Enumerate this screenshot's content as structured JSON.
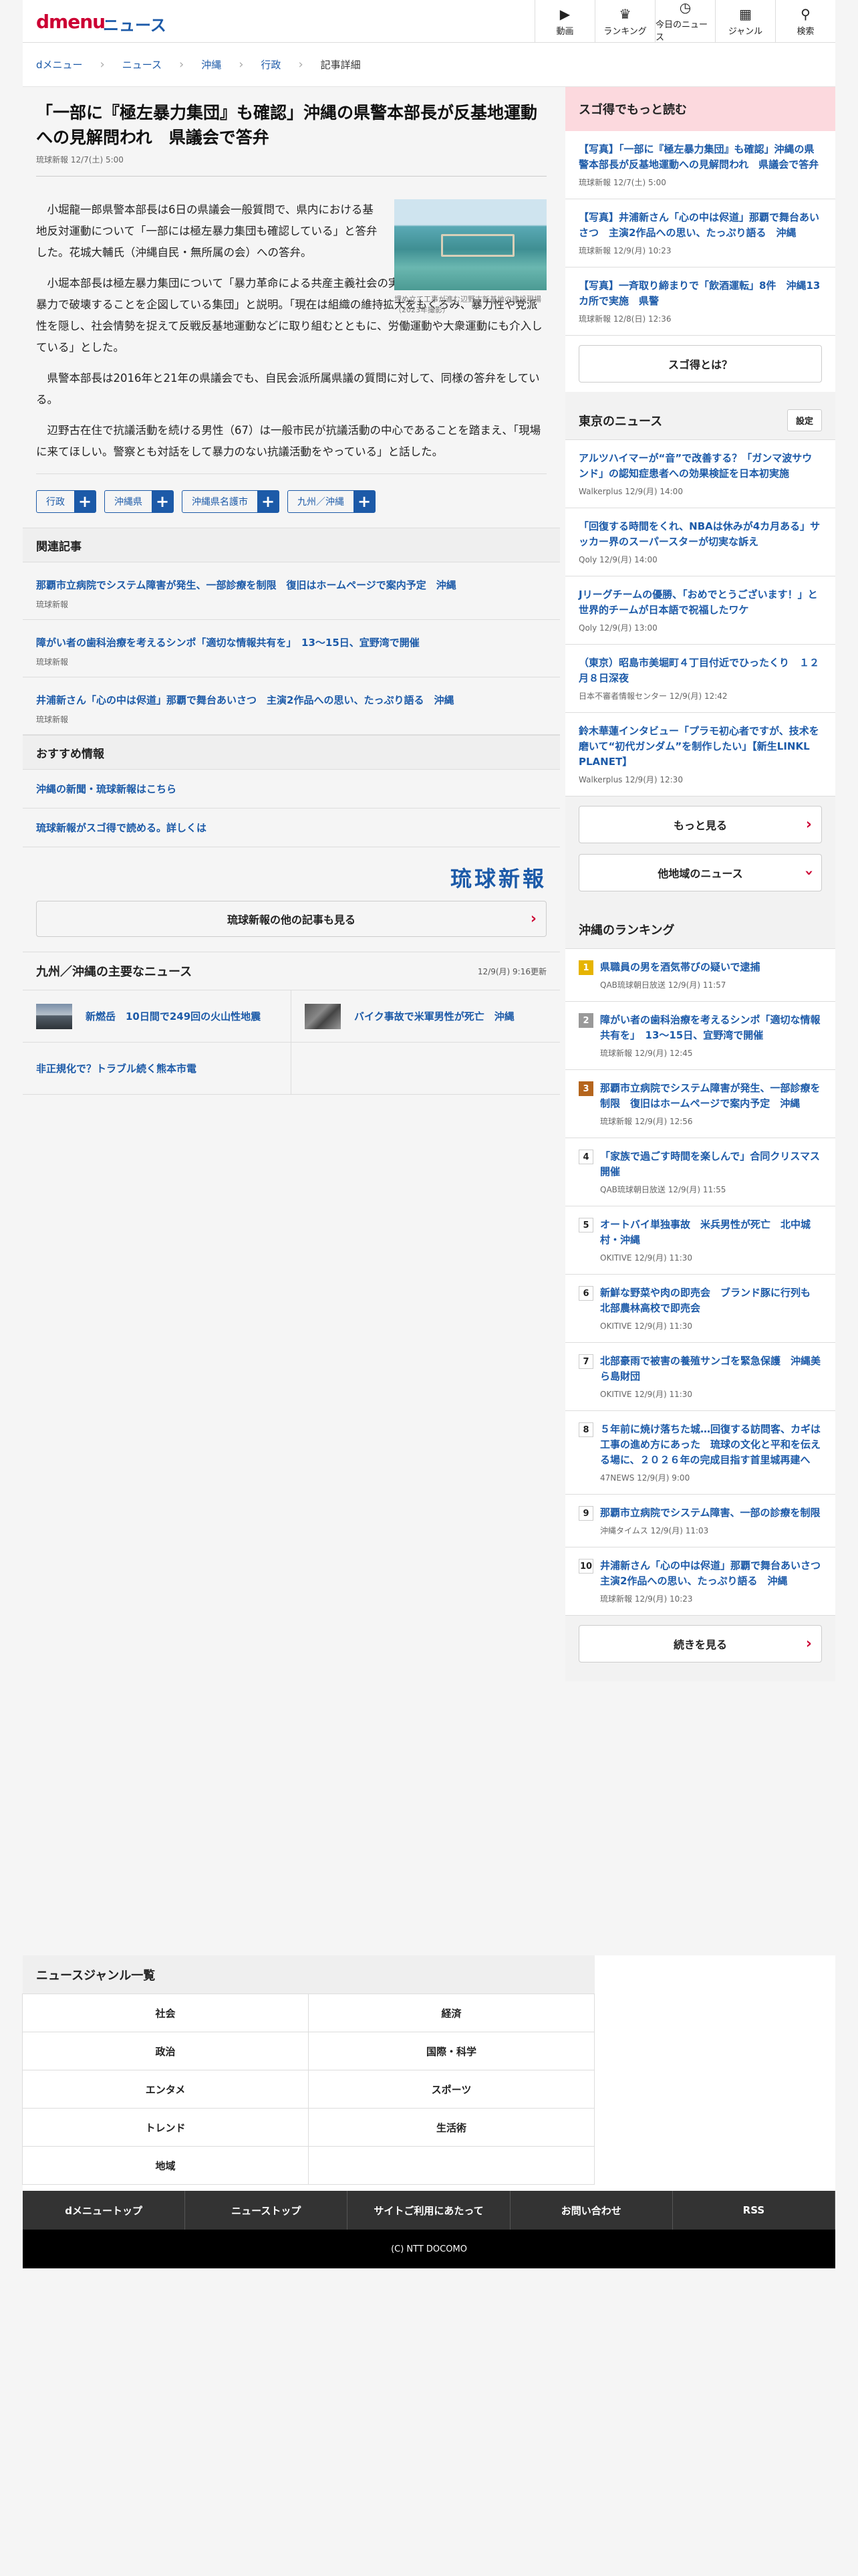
{
  "header": {
    "logo": "dmenu",
    "section": "ニュース",
    "nav": [
      {
        "icon": "video-icon",
        "glyph": "▶",
        "label": "動画"
      },
      {
        "icon": "trophy-icon",
        "glyph": "♛",
        "label": "ランキング"
      },
      {
        "icon": "clock-icon",
        "glyph": "◷",
        "label": "今日のニュース"
      },
      {
        "icon": "grid-icon",
        "glyph": "▦",
        "label": "ジャンル"
      },
      {
        "icon": "search-icon",
        "glyph": "⚲",
        "label": "検索"
      }
    ]
  },
  "breadcrumb": [
    "dメニュー",
    "ニュース",
    "沖縄",
    "行政",
    "記事詳細"
  ],
  "article": {
    "title": "「一部に『極左暴力集団』も確認」沖縄の県警本部長が反基地運動への見解問われ　県議会で答弁",
    "source": "琉球新報 12/7(土) 5:00",
    "caption": "埋め立て工事が進む辺野古新基地の建設現場（2023年撮影）",
    "paragraphs": [
      "小堀龍一郎県警本部長は6日の県議会一般質問で、県内における基地反対運動について「一部には極左暴力集団も確認している」と答弁した。花城大輔氏（沖縄自民・無所属の会）への答弁。",
      "小堀本部長は極左暴力集団について「暴力革命による共産主義社会の実現を目指し、民主主義社会を暴力で破壊することを企図している集団」と説明。「現在は組織の維持拡大をもくろみ、暴力性や党派性を隠し、社会情勢を捉えて反戦反基地運動などに取り組むとともに、労働運動や大衆運動にも介入している」とした。",
      "県警本部長は2016年と21年の県議会でも、自民会派所属県議の質問に対して、同様の答弁をしている。",
      "辺野古在住で抗議活動を続ける男性（67）は一般市民が抗議活動の中心であることを踏まえ、「現場に来てほしい。警察とも対話をして暴力のない抗議活動をやっている」と話した。"
    ],
    "tags": [
      "行政",
      "沖縄県",
      "沖縄県名護市",
      "九州／沖縄"
    ]
  },
  "related": {
    "heading": "関連記事",
    "items": [
      {
        "title": "那覇市立病院でシステム障害が発生、一部診療を制限　復旧はホームページで案内予定　沖縄",
        "source": "琉球新報"
      },
      {
        "title": "障がい者の歯科治療を考えるシンポ「適切な情報共有を」　13～15日、宜野湾で開催",
        "source": "琉球新報"
      },
      {
        "title": "井浦新さん「心の中は侭道」那覇で舞台あいさつ　主演2作品への思い、たっぷり語る　沖縄",
        "source": "琉球新報"
      }
    ]
  },
  "recommend": {
    "heading": "おすすめ情報",
    "items": [
      "沖縄の新聞・琉球新報はこちら",
      "琉球新報がスゴ得で読める。詳しくは"
    ],
    "brand": "琉球新報",
    "more": "琉球新報の他の記事も見る"
  },
  "kyushu": {
    "heading": "九州／沖縄の主要なニュース",
    "date": "12/9(月) 9:16更新",
    "items": [
      "新燃岳　10日間で249回の火山性地震",
      "バイク事故で米軍男性が死亡　沖縄",
      "非正規化で？トラブル続く熊本市電"
    ]
  },
  "sugoku": {
    "heading": "スゴ得でもっと読む",
    "items": [
      {
        "title": "【写真】「一部に『極左暴力集団』も確認」沖縄の県警本部長が反基地運動への見解問われ　県議会で答弁",
        "source": "琉球新報 12/7(土) 5:00"
      },
      {
        "title": "【写真】井浦新さん「心の中は侭道」那覇で舞台あいさつ　主演2作品への思い、たっぷり語る　沖縄",
        "source": "琉球新報 12/9(月) 10:23"
      },
      {
        "title": "【写真】一斉取り締まりで「飲酒運転」8件　沖縄13カ所で実施　県警",
        "source": "琉球新報 12/8(日) 12:36"
      }
    ],
    "button": "スゴ得とは？"
  },
  "tokyo": {
    "heading": "東京のニュース",
    "setting": "設定",
    "items": [
      {
        "title": "アルツハイマーが“音”で改善する？「ガンマ波サウンド」の認知症患者への効果検証を日本初実施",
        "source": "Walkerplus 12/9(月) 14:00"
      },
      {
        "title": "「回復する時間をくれ、NBAは休みが4カ月ある」サッカー界のスーパースターが切実な訴え",
        "source": "Qoly 12/9(月) 14:00"
      },
      {
        "title": "Jリーグチームの優勝、「おめでとうございます！」と世界的チームが日本語で祝福したワケ",
        "source": "Qoly 12/9(月) 13:00"
      },
      {
        "title": "（東京）昭島市美堀町４丁目付近でひったくり　１２月８日深夜",
        "source": "日本不審者情報センター 12/9(月) 12:42"
      },
      {
        "title": "鈴木華蓮インタビュー「プラモ初心者ですが、技术を磨いて“初代ガンダム”を制作したい」【新生LINKL PLANET】",
        "source": "Walkerplus 12/9(月) 12:30"
      }
    ],
    "more": "もっと見る",
    "other": "他地域のニュース"
  },
  "ranking": {
    "heading": "沖縄のランキング",
    "items": [
      {
        "rank": "1",
        "title": "県職員の男を酒気帯びの疑いで逮捕",
        "source": "QAB琉球朝日放送 12/9(月) 11:57"
      },
      {
        "rank": "2",
        "title": "障がい者の歯科治療を考えるシンポ「適切な情報共有を」　13～15日、宜野湾で開催",
        "source": "琉球新報 12/9(月) 12:45"
      },
      {
        "rank": "3",
        "title": "那覇市立病院でシステム障害が発生、一部診療を制限　復旧はホームページで案内予定　沖縄",
        "source": "琉球新報 12/9(月) 12:56"
      },
      {
        "rank": "4",
        "title": "「家族で過ごす時間を楽しんで」合同クリスマス開催",
        "source": "QAB琉球朝日放送 12/9(月) 11:55"
      },
      {
        "rank": "5",
        "title": "オートバイ単独事故　米兵男性が死亡　北中城村・沖縄",
        "source": "OKITIVE 12/9(月) 11:30"
      },
      {
        "rank": "6",
        "title": "新鮮な野菜や肉の即売会　ブランド豚に行列も　北部農林高校で即売会",
        "source": "OKITIVE 12/9(月) 11:30"
      },
      {
        "rank": "7",
        "title": "北部豪雨で被害の養殖サンゴを緊急保護　沖縄美ら島財団",
        "source": "OKITIVE 12/9(月) 11:30"
      },
      {
        "rank": "8",
        "title": "５年前に焼け落ちた城…回復する訪問客、カギは工事の進め方にあった　琉球の文化と平和を伝える場に、２０２６年の完成目指す首里城再建へ",
        "source": "47NEWS 12/9(月) 9:00"
      },
      {
        "rank": "9",
        "title": "那覇市立病院でシステム障害、一部の診療を制限",
        "source": "沖縄タイムス 12/9(月) 11:03"
      },
      {
        "rank": "10",
        "title": "井浦新さん「心の中は侭道」那覇で舞台あいさつ　主演2作品への思い、たっぷり語る　沖縄",
        "source": "琉球新報 12/9(月) 10:23"
      }
    ],
    "more": "続きを見る"
  },
  "genre": {
    "heading": "ニュースジャンル一覧",
    "items": [
      "社会",
      "経済",
      "政治",
      "国際・科学",
      "エンタメ",
      "スポーツ",
      "トレンド",
      "生活術",
      "地域",
      ""
    ]
  },
  "footer": {
    "nav": [
      "dメニュートップ",
      "ニューストップ",
      "サイトご利用にあたって",
      "お問い合わせ",
      "RSS"
    ],
    "copyright": "(C) NTT DOCOMO"
  }
}
